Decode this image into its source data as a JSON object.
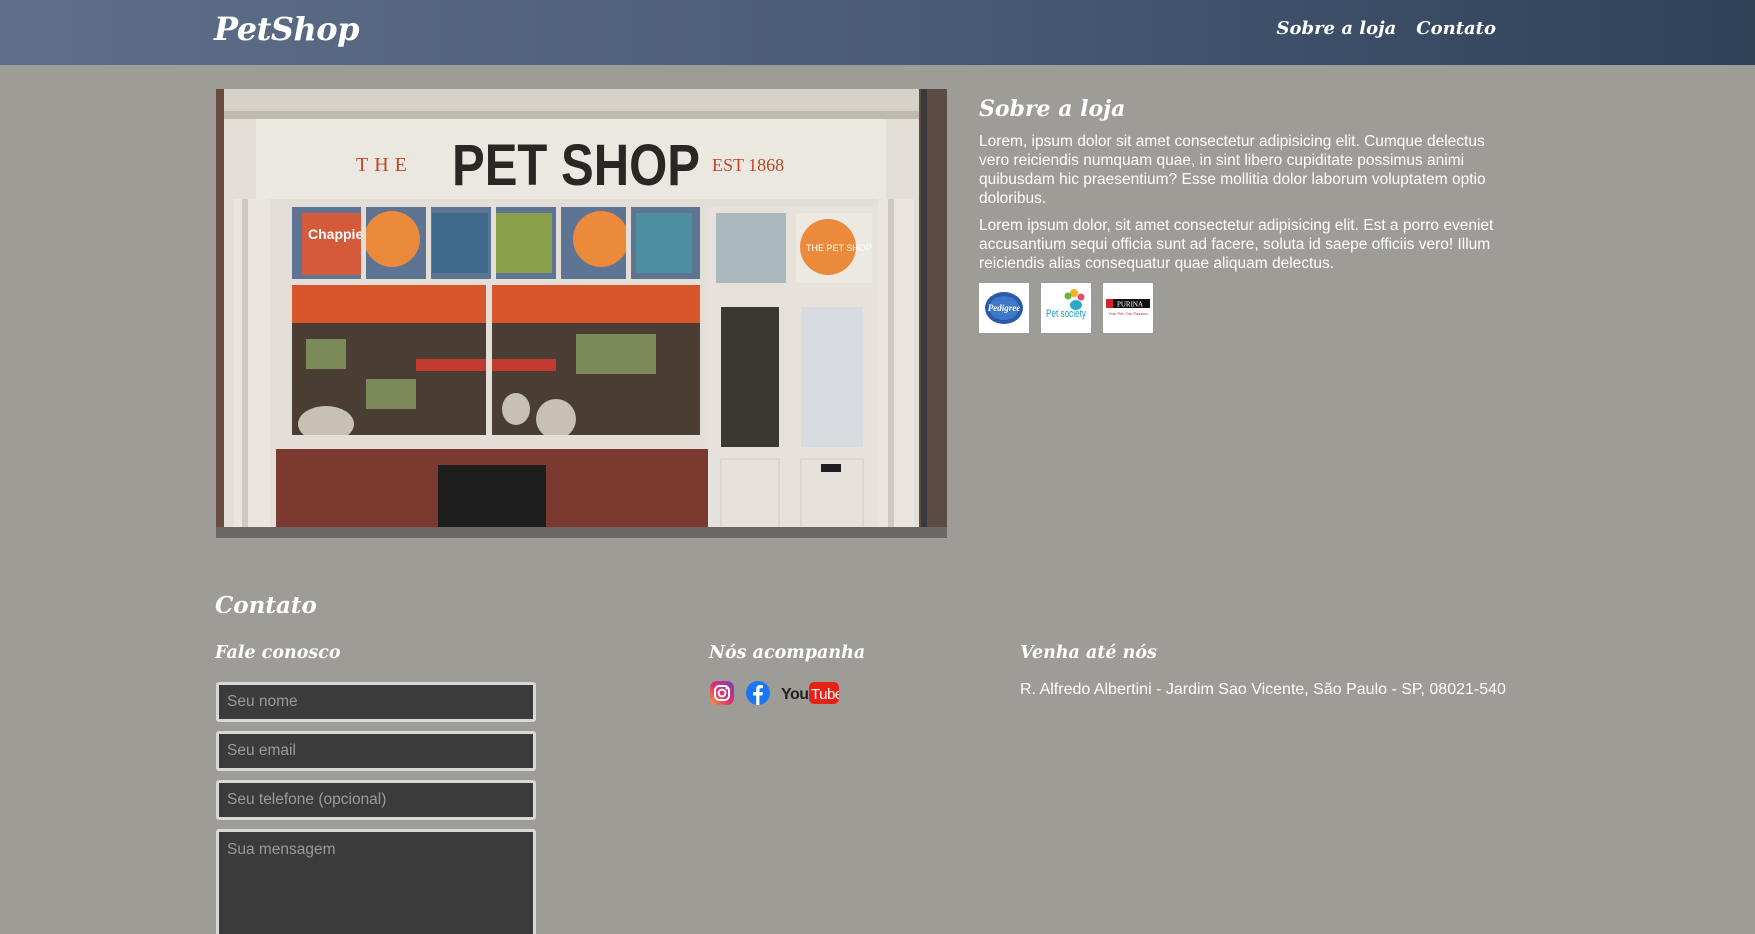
{
  "header": {
    "brand": "PetShop",
    "nav": [
      "Sobre a loja",
      "Contato"
    ]
  },
  "storefront": {
    "sign_the": "THE",
    "sign_main": "PET SHOP",
    "sign_est": "EST 1868",
    "window_brand": "Chappie",
    "decal_text": "THE PET SHOP"
  },
  "about": {
    "title": "Sobre a loja",
    "paragraphs": [
      "Lorem, ipsum dolor sit amet consectetur adipisicing elit. Cumque delectus vero reiciendis numquam quae, in sint libero cupiditate possimus animi quibusdam hic praesentium? Esse mollitia dolor laborum voluptatem optio doloribus.",
      "Lorem ipsum dolor, sit amet consectetur adipisicing elit. Est a porro eveniet accusantium sequi officia sunt ad facere, soluta id saepe officiis vero! Illum reiciendis alias consequatur quae aliquam delectus."
    ],
    "brands": [
      "Pedigree",
      "Pet society",
      "PURINA"
    ],
    "brand_tagline": "Your Pet, Our Passion"
  },
  "contact": {
    "title": "Contato",
    "form_title": "Fale conosco",
    "placeholders": {
      "name": "Seu nome",
      "email": "Seu email",
      "phone": "Seu telefone (opcional)",
      "message": "Sua mensagem"
    },
    "social_title": "Nós acompanha",
    "social": [
      "instagram-icon",
      "facebook-icon",
      "youtube-icon"
    ],
    "youtube_you": "You",
    "youtube_tube": "Tube",
    "address_title": "Venha até nós",
    "address": "R. Alfredo Albertini - Jardim Sao Vicente, São Paulo - SP, 08021-540"
  },
  "colors": {
    "background": "#9e9c97",
    "header_start": "#5f6f8a",
    "header_end": "#2f4258",
    "field_bg": "#3b3b3b"
  }
}
